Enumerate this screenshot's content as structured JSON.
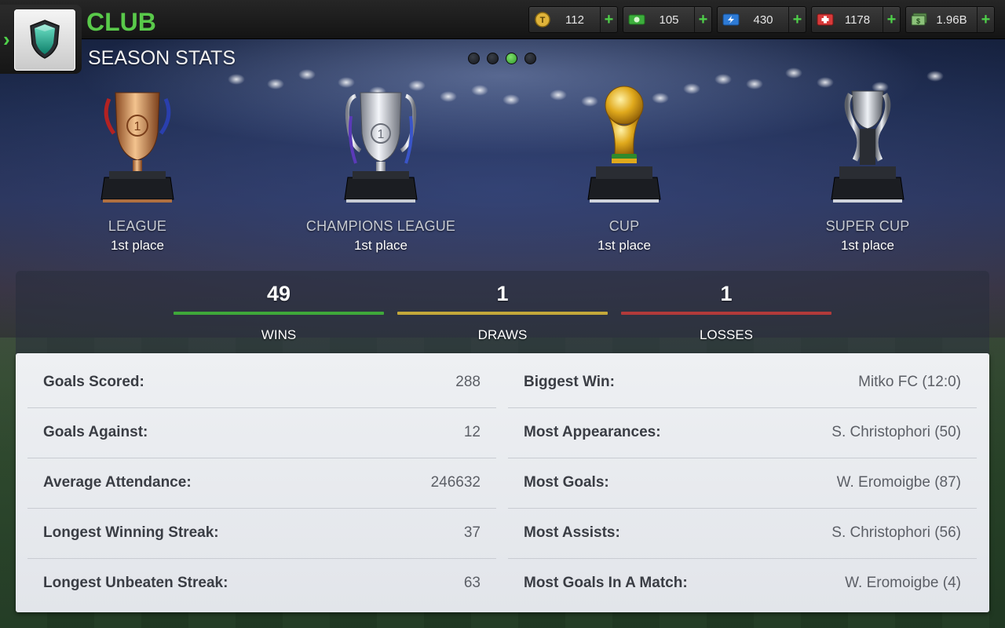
{
  "header": {
    "title": "CLUB",
    "subtitle": "SEASON STATS"
  },
  "currencies": [
    {
      "name": "tokens",
      "icon": "token-coin-icon",
      "value": "112",
      "color": "#e0b43a"
    },
    {
      "name": "cash",
      "icon": "cash-icon",
      "value": "105",
      "color": "#3cae3c"
    },
    {
      "name": "energy",
      "icon": "energy-icon",
      "value": "430",
      "color": "#2e7bd6"
    },
    {
      "name": "health",
      "icon": "medical-icon",
      "value": "1178",
      "color": "#d83a3a"
    },
    {
      "name": "money",
      "icon": "money-stack-icon",
      "value": "1.96B",
      "color": "#7bb06a"
    }
  ],
  "pager": {
    "count": 4,
    "active": 3
  },
  "trophies": [
    {
      "name": "LEAGUE",
      "place": "1st place",
      "kind": "league"
    },
    {
      "name": "CHAMPIONS LEAGUE",
      "place": "1st place",
      "kind": "champions"
    },
    {
      "name": "CUP",
      "place": "1st place",
      "kind": "cup"
    },
    {
      "name": "SUPER CUP",
      "place": "1st place",
      "kind": "supercup"
    }
  ],
  "record": {
    "wins": {
      "value": "49",
      "label": "WINS",
      "color": "#3fa83a"
    },
    "draws": {
      "value": "1",
      "label": "DRAWS",
      "color": "#c4a83a"
    },
    "losses": {
      "value": "1",
      "label": "LOSSES",
      "color": "#b23a3a"
    }
  },
  "stats_left": [
    {
      "label": "Goals Scored:",
      "value": "288"
    },
    {
      "label": "Goals Against:",
      "value": "12"
    },
    {
      "label": "Average Attendance:",
      "value": "246632"
    },
    {
      "label": "Longest Winning Streak:",
      "value": "37"
    },
    {
      "label": "Longest Unbeaten Streak:",
      "value": "63"
    }
  ],
  "stats_right": [
    {
      "label": "Biggest Win:",
      "value": "Mitko FC (12:0)"
    },
    {
      "label": "Most Appearances:",
      "value": "S. Christophori (50)"
    },
    {
      "label": "Most Goals:",
      "value": "W. Eromoigbe (87)"
    },
    {
      "label": "Most Assists:",
      "value": "S. Christophori (56)"
    },
    {
      "label": "Most Goals In A Match:",
      "value": "W. Eromoigbe (4)"
    }
  ]
}
